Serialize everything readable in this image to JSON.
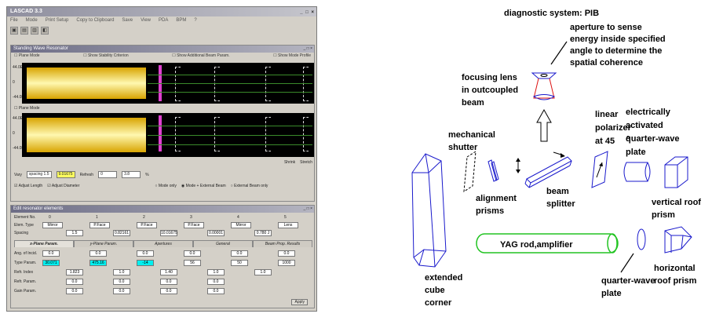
{
  "window": {
    "title": "LASCAD 3.3",
    "menu": [
      "File",
      "Mode",
      "Print Setup",
      "Copy to Clipboard",
      "Save",
      "View",
      "PDA",
      "BPM",
      "?"
    ],
    "sub1_title": "Standing Wave Resonator",
    "opt_left": "Plane Mode",
    "opt_mid1": "Show Stability Criterion",
    "opt_mid2": "Show Additional Beam Param.",
    "opt_right": "Show Mode Profile",
    "plane_mode": "Plane Mode",
    "ticks": [
      "44.0E",
      "0",
      "-44.0E"
    ],
    "ctrl1": {
      "vary": "Vary",
      "spacing": "spacing",
      "spacing_val": "1.5",
      "val2": "9.01675",
      "refr_label": "Refresh",
      "refr_val": "0",
      "refr_val2": "3.8",
      "pct": "%"
    },
    "ctrl2": {
      "adjust_length": "Adjust Length",
      "adjust_diameter": "Adjust Diameter",
      "r1": "Mode only",
      "r2": "Mode + External Beam",
      "r3": "External Beam only"
    },
    "sub2_title": "Edit resonator elements",
    "element_no_label": "Element No.",
    "elem_type_label": "Elem. Type",
    "spacing_label": "Spacing",
    "element_nos": [
      "0",
      "1",
      "2",
      "3",
      "4",
      "5"
    ],
    "elem_types": [
      "Mirror",
      "P.Face",
      "P.Face",
      "P.Face",
      "Mirror",
      "Lens"
    ],
    "spacings": [
      "1.5",
      "0.82161",
      "10.01675",
      "0.00001",
      "0.780 J"
    ],
    "tabs": [
      "x-Plane Param.",
      "y-Plane Param.",
      "Apertures",
      "General",
      "Beam Prop. Results"
    ],
    "rows": [
      {
        "label": "Ang. of Incid.",
        "vals": [
          "0.0",
          "0.0",
          "0.0",
          "0.0",
          "0.0",
          "0.0"
        ]
      },
      {
        "label": "Type Param.",
        "vals": [
          "30.071",
          "475.16",
          "-14",
          "56",
          "50",
          "1000"
        ]
      },
      {
        "label": "Refr. Index",
        "vals": [
          "1.823",
          "1.0",
          "1.40",
          "1.0",
          "1.0"
        ]
      },
      {
        "label": "Refr. Param.",
        "vals": [
          "0.0",
          "0.0",
          "0.0",
          "0.0"
        ]
      },
      {
        "label": "Gain Param.",
        "vals": [
          "0.0",
          "0.0",
          "0.0",
          "0.0"
        ]
      }
    ],
    "apply": "Apply",
    "scroll_btns": [
      "Shrink",
      "Stretch"
    ]
  },
  "diagram": {
    "title": "diagnostic system: PIB",
    "aperture": [
      "aperture to sense",
      "energy inside specified",
      "angle to determine the",
      "spatial coherence"
    ],
    "focusing_lens": [
      "focusing lens",
      "in outcoupled",
      "beam"
    ],
    "linear_polarizer": [
      "linear",
      "polarizer",
      "at 45",
      "o"
    ],
    "electrically_activated": [
      "electrically",
      "activated",
      "quarter-wave",
      "plate"
    ],
    "mechanical_shutter": [
      "mechanical",
      "shutter"
    ],
    "alignment_prisms": [
      "alignment",
      "prisms"
    ],
    "beam_splitter": [
      "beam",
      "splitter"
    ],
    "vertical_roof": [
      "vertical roof",
      "prism"
    ],
    "yag_rod": "YAG rod,amplifier",
    "extended_cube": [
      "extended",
      "cube",
      "corner"
    ],
    "quarter_wave": [
      "quarter-wave",
      "plate"
    ],
    "horizontal_roof": [
      "horizontal",
      "roof prism"
    ]
  }
}
